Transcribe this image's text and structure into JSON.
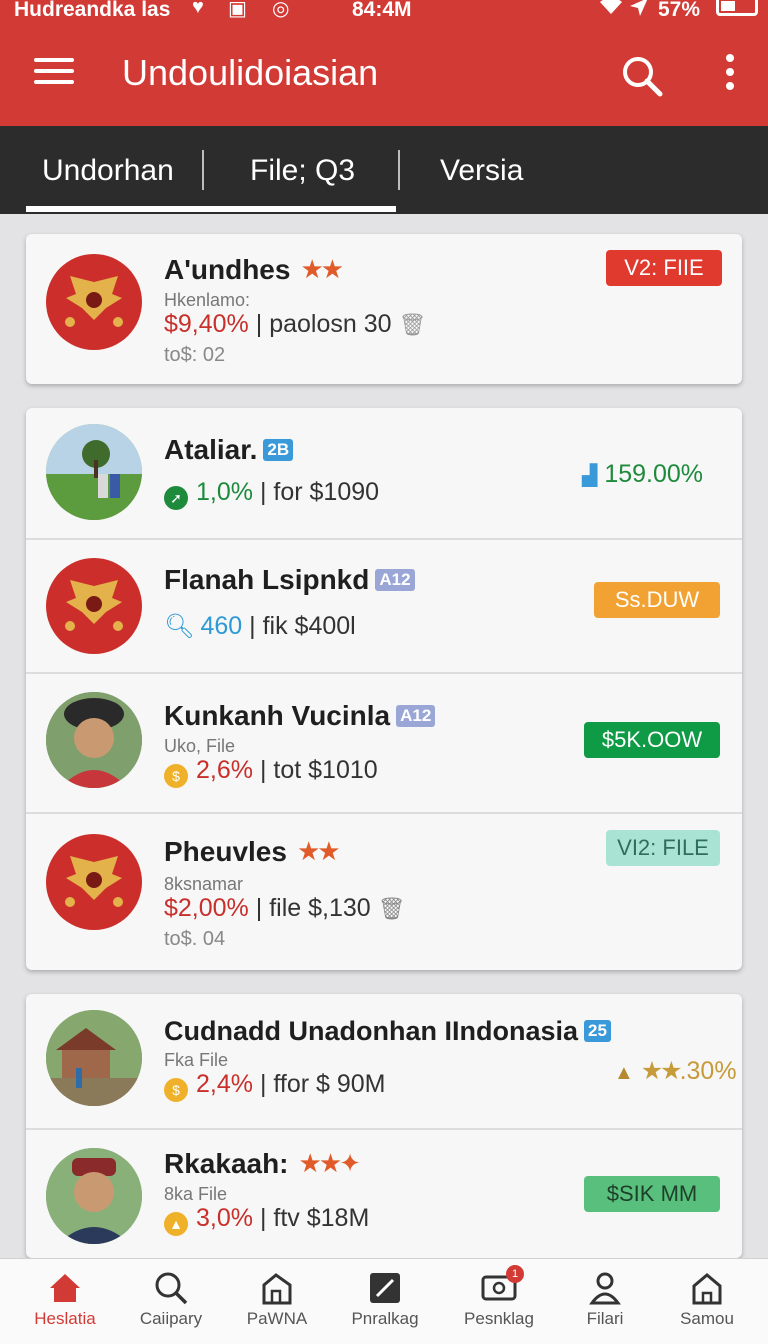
{
  "status": {
    "carrier": "Hudreandka las",
    "time": "84:4M",
    "battery": "57%",
    "icons": [
      "heart-icon",
      "sim-icon",
      "sync-icon",
      "wifi-icon",
      "navigation-icon",
      "battery-icon"
    ]
  },
  "app": {
    "title": "Undoulidoiasian"
  },
  "tabs": [
    {
      "label": "Undorhan",
      "active": true
    },
    {
      "label": "File; Q3"
    },
    {
      "label": "Versia"
    }
  ],
  "cards": [
    {
      "rows": [
        {
          "avatar": "emblem-avatar",
          "name": "A'undhes",
          "rating": "★★",
          "subtitle": "Hkenlamo:",
          "percent": "$9,40%",
          "detail": "paolosn 30",
          "footer": "to$: 02",
          "badge": "V2: FIIE",
          "badge_color": "#e0392e"
        }
      ]
    },
    {
      "rows": [
        {
          "avatar": "field-photo-avatar",
          "name": "Ataliar.",
          "tag": "2B",
          "tag_color": "#3a9ad9",
          "percent": "1,0%",
          "detail": "for $1090",
          "right_value": "159.00%",
          "right_color": "#1e8a3c"
        },
        {
          "avatar": "emblem-avatar",
          "name": "Flanah Lsipnkd",
          "tag": "A12",
          "tag_color": "#9aa7d6",
          "percent": "460",
          "detail": "fik $400l",
          "badge": "Ss.DUW",
          "badge_color": "#f1a232"
        },
        {
          "avatar": "person-avatar",
          "name": "Kunkanh Vucinla",
          "tag": "A12",
          "tag_color": "#9aa7d6",
          "subtitle": "Uko, File",
          "percent": "2,6%",
          "detail": "tot $1010",
          "badge": "$5K.OOW",
          "badge_color": "#0f9a45"
        },
        {
          "avatar": "emblem-avatar",
          "name": "Pheuvles",
          "rating": "★★",
          "subtitle": "8ksnamar",
          "percent": "$2,00%",
          "detail": "file $,130",
          "footer": "to$. 04",
          "badge": "VI2: FILE",
          "badge_color": "#a8e3d3"
        }
      ]
    },
    {
      "rows": [
        {
          "avatar": "village-photo-avatar",
          "name": "Cudnadd Unadonhan IIndonasia",
          "tag": "25",
          "tag_color": "#3a9ad9",
          "subtitle": "Fka File",
          "percent": "2,4%",
          "detail": "ffor $ 90M",
          "right_value": ".30%",
          "right_color": "#c79a3a",
          "right_rating": "★★"
        },
        {
          "avatar": "man-photo-avatar",
          "name": "Rkakaah:",
          "rating": "★★✦",
          "subtitle": "8ka File",
          "percent": "3,0%",
          "detail": "ftv $18M",
          "badge": "$SIK MM",
          "badge_color": "#58c07c"
        }
      ]
    }
  ],
  "bottom_nav": [
    {
      "label": "Heslatia",
      "icon": "home-icon",
      "active": true
    },
    {
      "label": "Caiipary",
      "icon": "search-icon"
    },
    {
      "label": "PaWNA",
      "icon": "building-icon"
    },
    {
      "label": "Pnralkag",
      "icon": "edit-box-icon"
    },
    {
      "label": "Pesnklag",
      "icon": "money-icon",
      "notification": "1"
    },
    {
      "label": "Filari",
      "icon": "person-icon"
    },
    {
      "label": "Samou",
      "icon": "house-outline-icon"
    }
  ]
}
